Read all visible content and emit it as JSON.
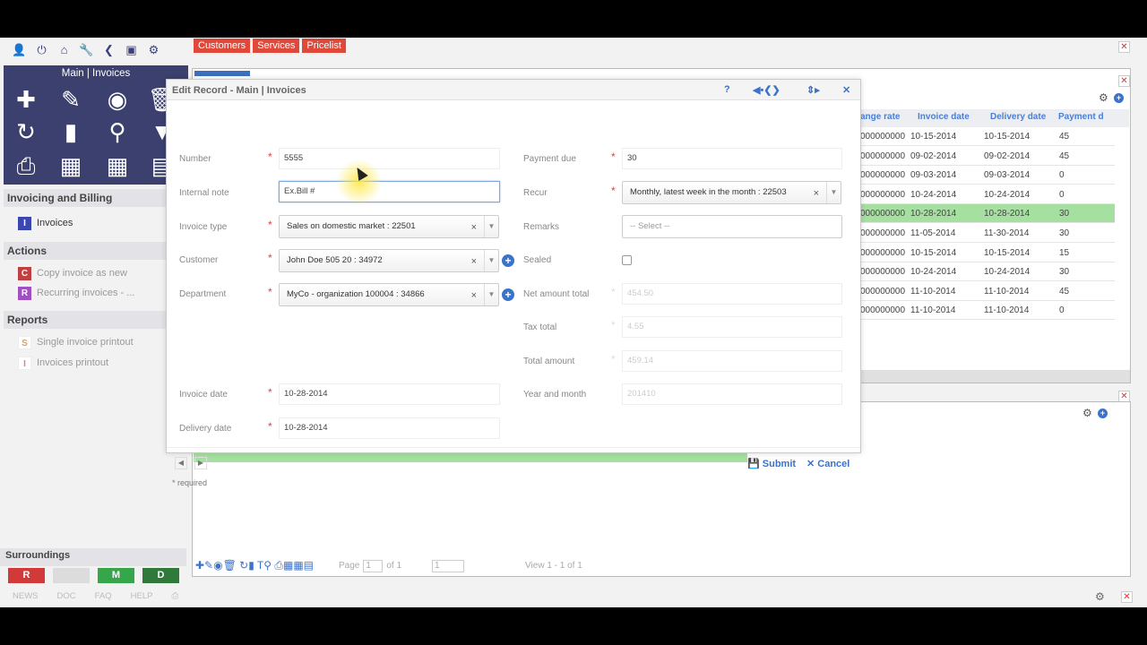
{
  "top_icons": [
    "user-icon",
    "power-icon",
    "home-icon",
    "wrench-icon",
    "back-icon",
    "window-icon",
    "gear-icon"
  ],
  "top_tabs": [
    "Customers",
    "Services",
    "Pricelist"
  ],
  "left_panel": {
    "header": "Main | Invoices",
    "sections": {
      "invoicing": "Invoicing and Billing",
      "actions": "Actions",
      "reports": "Reports"
    },
    "items": {
      "invoices": {
        "badge": "I",
        "label": "Invoices",
        "color": "#3c46b0"
      },
      "copy": {
        "badge": "C",
        "label": "Copy invoice as new",
        "color": "#c04040"
      },
      "recurring": {
        "badge": "R",
        "label": "Recurring invoices - ...",
        "color": "#a050c0"
      },
      "single": {
        "badge": "S",
        "label": "Single invoice printout",
        "color": "#e0a060"
      },
      "printout": {
        "badge": "I",
        "label": "Invoices printout",
        "color": "#e08080"
      }
    },
    "surroundings": "Surroundings",
    "sur_buttons": [
      {
        "label": "R",
        "color": "#d23a3a"
      },
      {
        "label": "",
        "color": "#dcdcdc"
      },
      {
        "label": "M",
        "color": "#36a64a"
      },
      {
        "label": "D",
        "color": "#2f7a3a"
      }
    ],
    "footer_links": [
      "NEWS",
      "DOC",
      "FAQ",
      "HELP"
    ]
  },
  "grid": {
    "headers": [
      "ange rate",
      "Invoice date",
      "Delivery date",
      "Payment d"
    ],
    "rows": [
      [
        "000000000",
        "10-15-2014",
        "10-15-2014",
        "45"
      ],
      [
        "000000000",
        "09-02-2014",
        "09-02-2014",
        "45"
      ],
      [
        "000000000",
        "09-03-2014",
        "09-03-2014",
        "0"
      ],
      [
        "000000000",
        "10-24-2014",
        "10-24-2014",
        "0"
      ],
      [
        "000000000",
        "10-28-2014",
        "10-28-2014",
        "30"
      ],
      [
        "000000000",
        "11-05-2014",
        "11-30-2014",
        "30"
      ],
      [
        "000000000",
        "10-15-2014",
        "10-15-2014",
        "15"
      ],
      [
        "000000000",
        "10-24-2014",
        "10-24-2014",
        "30"
      ],
      [
        "000000000",
        "11-10-2014",
        "11-10-2014",
        "45"
      ],
      [
        "000000000",
        "11-10-2014",
        "11-10-2014",
        "0"
      ]
    ],
    "highlight_row": 4,
    "pager": {
      "page_label": "Page",
      "page_value": "1",
      "of_label": "of 1",
      "rows_value": "1",
      "view_text": "View 1 - 1 of 1"
    }
  },
  "modal": {
    "title": "Edit Record - Main | Invoices",
    "left": {
      "number": {
        "label": "Number",
        "value": "5555"
      },
      "internal_note": {
        "label": "Internal note",
        "value": "Ex.Bill #"
      },
      "invoice_type": {
        "label": "Invoice type",
        "value": "Sales on domestic market : 22501"
      },
      "customer": {
        "label": "Customer",
        "value": "John Doe 505 20 : 34972"
      },
      "department": {
        "label": "Department",
        "value": "MyCo - organization 100004 : 34866"
      },
      "invoice_date": {
        "label": "Invoice date",
        "value": "10-28-2014"
      },
      "delivery_date": {
        "label": "Delivery date",
        "value": "10-28-2014"
      }
    },
    "right": {
      "payment_due": {
        "label": "Payment due",
        "value": "30"
      },
      "recur": {
        "label": "Recur",
        "value": "Monthly, latest week in the month : 22503"
      },
      "remarks": {
        "label": "Remarks",
        "placeholder": "-- Select --"
      },
      "sealed": {
        "label": "Sealed"
      },
      "net_amount": {
        "label": "Net amount total",
        "value": "454.50"
      },
      "tax_total": {
        "label": "Tax total",
        "value": "4.55"
      },
      "total_amount": {
        "label": "Total amount",
        "value": "459.14"
      },
      "year_month": {
        "label": "Year and month",
        "value": "201410"
      }
    },
    "submit": "Submit",
    "cancel": "Cancel",
    "required_note": "* required"
  }
}
